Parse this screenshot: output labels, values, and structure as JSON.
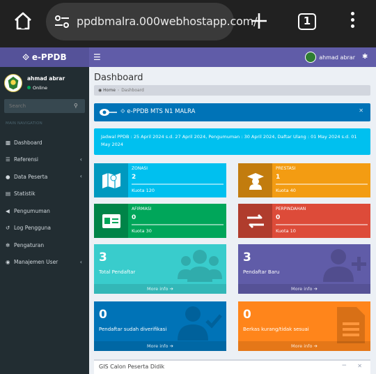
{
  "browser": {
    "url": "ppdbmalra.000webhostapp.com/",
    "tab_count": "1"
  },
  "app": {
    "logo_text": "e-PPDB",
    "user_name": "ahmad abrar"
  },
  "sidebar": {
    "user_name": "ahmad abrar",
    "status": "Online",
    "search_placeholder": "Search",
    "header": "MAIN NAVIGATION",
    "items": [
      {
        "label": "Dashboard",
        "icon": "dashboard-icon",
        "chevron": false
      },
      {
        "label": "Referensi",
        "icon": "list-icon",
        "chevron": true
      },
      {
        "label": "Data Peserta",
        "icon": "user-icon",
        "chevron": true
      },
      {
        "label": "Statistik",
        "icon": "chart-icon",
        "chevron": false
      },
      {
        "label": "Pengumuman",
        "icon": "bullhorn-icon",
        "chevron": false
      },
      {
        "label": "Log Pengguna",
        "icon": "history-icon",
        "chevron": false
      },
      {
        "label": "Pengaturan",
        "icon": "gear-icon",
        "chevron": false
      },
      {
        "label": "Manajemen User",
        "icon": "users-icon",
        "chevron": true
      }
    ]
  },
  "content": {
    "title": "Dashboard",
    "breadcrumb": {
      "home": "Home",
      "current": "Dashboard"
    },
    "callout_title": "e-PPDB MTS N1 MALRA",
    "callout_info": "Jadwal PPDB : 25 April 2024 s.d. 27 April 2024, Pengumuman : 30 April 2024, Daftar Ulang : 01 May 2024 s.d. 01 May 2024",
    "info_boxes": [
      {
        "label": "ZONASI",
        "number": "2",
        "desc": "Kuota 120",
        "color": "#00c0ef",
        "icon": "map-icon"
      },
      {
        "label": "PRESTASI",
        "number": "1",
        "desc": "Kuota 40",
        "color": "#f39c12",
        "icon": "graduate-icon"
      },
      {
        "label": "AFIRMASI",
        "number": "0",
        "desc": "Kuota 30",
        "color": "#00a65a",
        "icon": "id-card-icon"
      },
      {
        "label": "PERPINDAHAN",
        "number": "0",
        "desc": "Kuota 10",
        "color": "#dd4b39",
        "icon": "exchange-icon"
      }
    ],
    "small_boxes": [
      {
        "number": "3",
        "label": "Total Pendaftar",
        "link": "More info",
        "color": "#39cccc",
        "icon": "users-icon"
      },
      {
        "number": "3",
        "label": "Pendaftar Baru",
        "link": "More info",
        "color": "#605ca8",
        "icon": "user-plus-icon"
      },
      {
        "number": "0",
        "label": "Pendaftar sudah diverifikasi",
        "link": "More info",
        "color": "#0073b7",
        "icon": "user-check-icon"
      },
      {
        "number": "0",
        "label": "Berkas kurang/tidak sesuai",
        "link": "More info",
        "color": "#ff851b",
        "icon": "file-icon"
      }
    ],
    "gis_title": "GIS Calon Peserta Didik"
  }
}
